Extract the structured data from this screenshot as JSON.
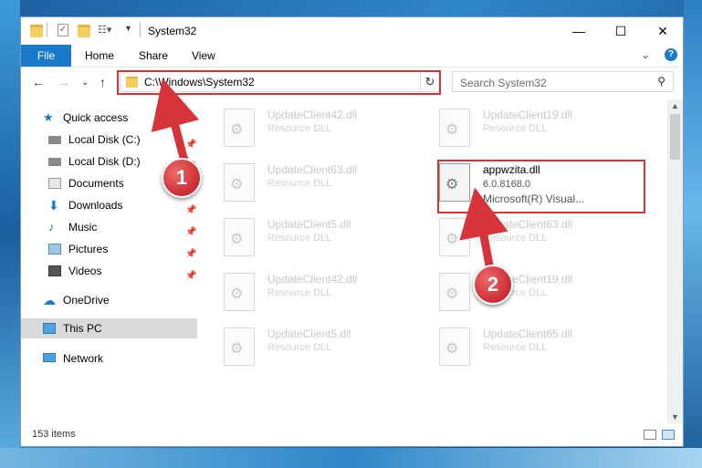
{
  "window": {
    "title": "System32",
    "controls": {
      "minimize": "—",
      "maximize": "☐",
      "close": "✕"
    }
  },
  "ribbon": {
    "tabs": [
      "File",
      "Home",
      "Share",
      "View"
    ],
    "help": "?"
  },
  "nav": {
    "address": "C:\\Windows\\System32",
    "search_placeholder": "Search System32"
  },
  "sidebar": {
    "items": [
      {
        "label": "Quick access",
        "icon": "star-icon",
        "pinned": false
      },
      {
        "label": "Local Disk (C:)",
        "icon": "drive-icon",
        "pinned": true
      },
      {
        "label": "Local Disk (D:)",
        "icon": "drive-icon",
        "pinned": true
      },
      {
        "label": "Documents",
        "icon": "documents-icon",
        "pinned": true
      },
      {
        "label": "Downloads",
        "icon": "download-icon",
        "pinned": true
      },
      {
        "label": "Music",
        "icon": "music-icon",
        "pinned": true
      },
      {
        "label": "Pictures",
        "icon": "pictures-icon",
        "pinned": true
      },
      {
        "label": "Videos",
        "icon": "video-icon",
        "pinned": true
      },
      {
        "label": "OneDrive",
        "icon": "cloud-icon",
        "pinned": false
      },
      {
        "label": "This PC",
        "icon": "computer-icon",
        "pinned": false
      },
      {
        "label": "Network",
        "icon": "network-icon",
        "pinned": false
      }
    ]
  },
  "files": [
    {
      "name": "UpdateClient42.dll",
      "type": "Resource DLL"
    },
    {
      "name": "UpdateClient19.dll",
      "type": "Resource DLL"
    },
    {
      "name": "UpdateClient63.dll",
      "type": "Resource DLL"
    },
    {
      "name": "appwzita.dll",
      "version": "6.0.8168.0",
      "company": "Microsoft(R) Visual..."
    },
    {
      "name": "UpdateClient5.dll",
      "type": "Resource DLL"
    },
    {
      "name": "UpdateClient63.dll",
      "type": "Resource DLL"
    },
    {
      "name": "UpdateClient42.dll",
      "type": "Resource DLL"
    },
    {
      "name": "UpdateClient19.dll",
      "type": "Resource DLL"
    },
    {
      "name": "UpdateClient5.dll",
      "type": "Resource DLL"
    },
    {
      "name": "UpdateClient65.dll",
      "type": "Resource DLL"
    }
  ],
  "status": {
    "count": "153 items"
  },
  "markers": [
    "1",
    "2"
  ],
  "colors": {
    "accent": "#1979ca",
    "highlight": "#d6333b",
    "selected": "#d9d9d9"
  }
}
